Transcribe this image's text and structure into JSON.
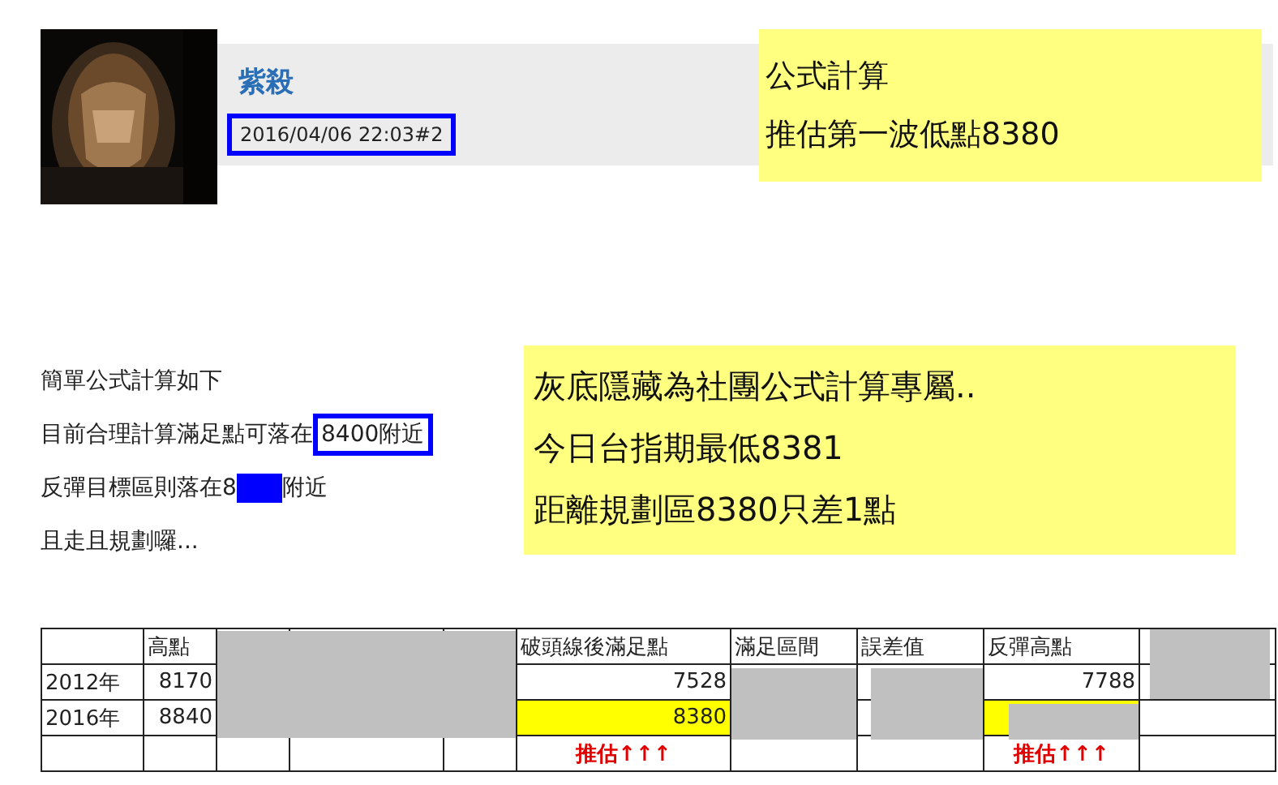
{
  "post": {
    "author": "紫殺",
    "timestamp": "2016/04/06 22:03#2"
  },
  "header_note": [
    "公式計算",
    "推估第一波低點8380"
  ],
  "body_lines": [
    {
      "kind": "plain",
      "text": "簡單公式計算如下"
    },
    {
      "kind": "boxed",
      "text": "目前合理計算滿足點可落在",
      "boxed": "8400附近"
    },
    {
      "kind": "redacted",
      "text": "反彈目標區則落在8",
      "after": "附近"
    },
    {
      "kind": "plain",
      "text": "且走且規劃囉..."
    }
  ],
  "side_note": [
    "灰底隱藏為社團公式計算專屬..",
    "今日台指期最低8381",
    "距離規劃區8380只差1點"
  ],
  "table": {
    "columns": [
      {},
      {
        "label": "高點"
      },
      {},
      {},
      {},
      {
        "label": "破頭線後滿足點"
      },
      {
        "label": "滿足區間"
      },
      {
        "label": "誤差值"
      },
      {
        "label": "反彈高點"
      },
      {}
    ],
    "rows": [
      [
        {
          "kind": "label",
          "text": "2012年"
        },
        {
          "kind": "number",
          "text": "8170"
        },
        {},
        {},
        {},
        {
          "kind": "number",
          "text": "7528"
        },
        {},
        {},
        {
          "kind": "number",
          "text": "7788"
        },
        {}
      ],
      [
        {
          "kind": "label",
          "text": "2016年"
        },
        {
          "kind": "number",
          "text": "8840"
        },
        {},
        {},
        {},
        {
          "kind": "marked",
          "text": "8380"
        },
        {},
        {},
        {
          "kind": "marked"
        },
        {}
      ],
      [
        {},
        {},
        {},
        {},
        {},
        {
          "kind": "estimate",
          "text": "推估↑↑↑"
        },
        {},
        {},
        {
          "kind": "estimate",
          "text": "推估↑↑↑"
        },
        {}
      ]
    ]
  }
}
